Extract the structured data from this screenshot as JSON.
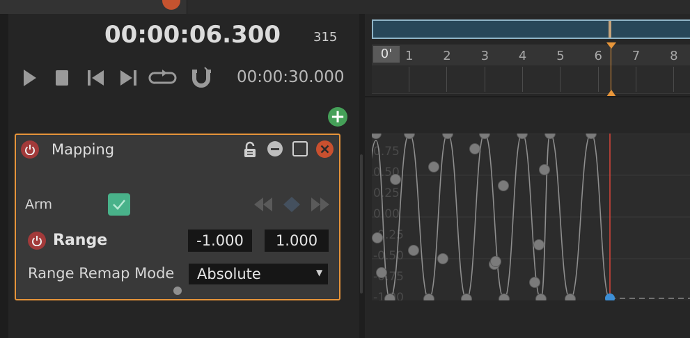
{
  "transport": {
    "current_time": "00:00:06.300",
    "frame": "315",
    "total_time": "00:00:30.000",
    "buttons": [
      "play",
      "stop",
      "prev-keyframe",
      "next-keyframe",
      "loop",
      "snap-magnet"
    ]
  },
  "timeline": {
    "zero_label": "0'",
    "ruler_numbers": [
      "1",
      "2",
      "3",
      "4",
      "5",
      "6",
      "7",
      "8"
    ],
    "playhead_seconds": 6.3
  },
  "mapping_panel": {
    "title": "Mapping",
    "arm_label": "Arm",
    "arm_checked": true,
    "range_label": "Range",
    "range_min": "-1.000",
    "range_max": "1.000",
    "remap_label": "Range Remap Mode",
    "remap_value": "Absolute"
  },
  "curve_view": {
    "axis_labels": [
      "0.75",
      "0.50",
      "0.25",
      "0.00",
      "-0.25",
      "-0.50",
      "-0.75",
      "-1.00"
    ]
  },
  "colors": {
    "accent_orange": "#e6943a",
    "power_red": "#a23a3a",
    "close_red": "#c9502f",
    "add_green": "#45a058",
    "arm_green": "#49b28a",
    "overview_blue": "#284759",
    "playhead_red": "#d9453a"
  }
}
